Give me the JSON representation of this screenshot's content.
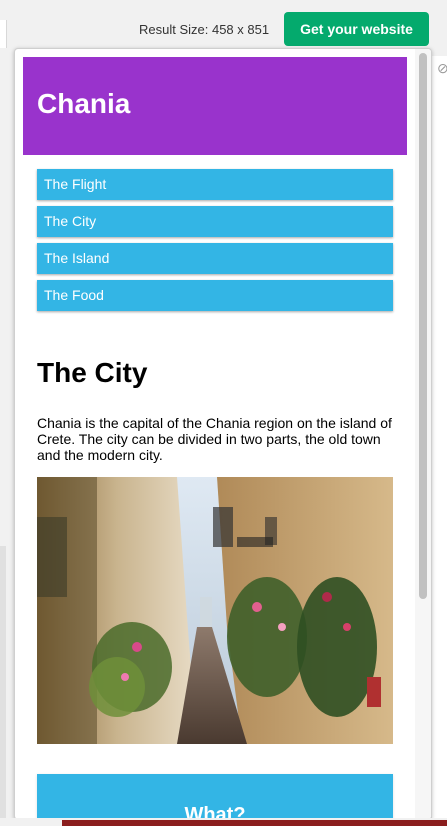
{
  "toolbar": {
    "result_size": "Result Size: 458 x 851",
    "get_website_label": "Get your website"
  },
  "page": {
    "header_title": "Chania",
    "menu": [
      "The Flight",
      "The City",
      "The Island",
      "The Food"
    ],
    "content_title": "The City",
    "content_text": "Chania is the capital of the Chania region on the island of Crete. The city can be divided in two parts, the old town and the modern city.",
    "aside_title": "What?"
  },
  "colors": {
    "header": "#9933cc",
    "menu": "#33b5e5",
    "button": "#04aa6d"
  }
}
